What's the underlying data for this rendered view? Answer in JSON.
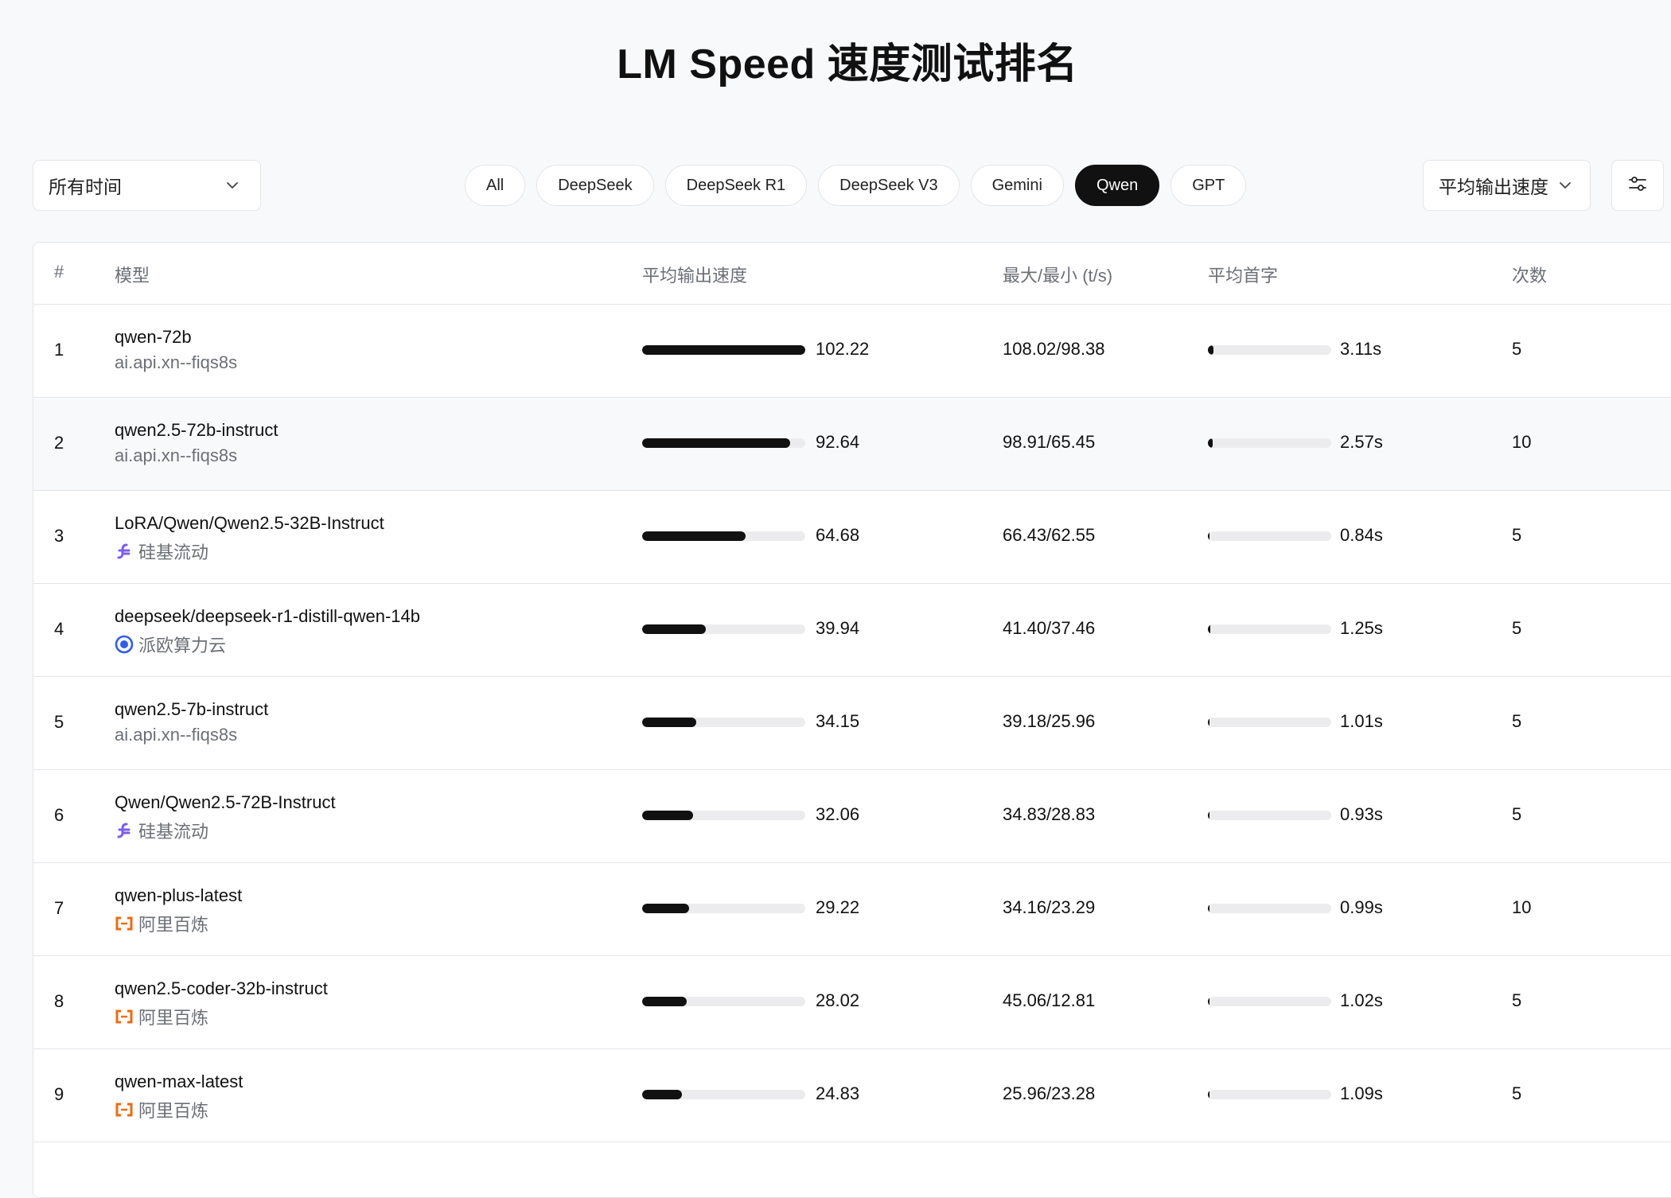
{
  "title": "LM Speed 速度测试排名",
  "time_filter": {
    "value": "所有时间"
  },
  "model_filters": [
    {
      "label": "All",
      "active": false
    },
    {
      "label": "DeepSeek",
      "active": false
    },
    {
      "label": "DeepSeek R1",
      "active": false
    },
    {
      "label": "DeepSeek V3",
      "active": false
    },
    {
      "label": "Gemini",
      "active": false
    },
    {
      "label": "Qwen",
      "active": true
    },
    {
      "label": "GPT",
      "active": false
    }
  ],
  "sort_select": {
    "value": "平均输出速度"
  },
  "table": {
    "headers": {
      "rank": "#",
      "model": "模型",
      "avg_speed": "平均输出速度",
      "max_min": "最大/最小 (t/s)",
      "avg_ttft": "平均首字",
      "count": "次数"
    },
    "max_speed": 102.22,
    "rows": [
      {
        "rank": "1",
        "model": "qwen-72b",
        "provider": "ai.api.xn--fiqs8s",
        "provider_icon": "none",
        "speed": "102.22",
        "speed_value": 102.22,
        "max_min": "108.02/98.38",
        "ttft": "3.11s",
        "ttft_fraction": 0.045,
        "count": "5"
      },
      {
        "rank": "2",
        "model": "qwen2.5-72b-instruct",
        "provider": "ai.api.xn--fiqs8s",
        "provider_icon": "none",
        "speed": "92.64",
        "speed_value": 92.64,
        "max_min": "98.91/65.45",
        "ttft": "2.57s",
        "ttft_fraction": 0.037,
        "count": "10"
      },
      {
        "rank": "3",
        "model": "LoRA/Qwen/Qwen2.5-32B-Instruct",
        "provider": "硅基流动",
        "provider_icon": "siliconflow-icon",
        "speed": "64.68",
        "speed_value": 64.68,
        "max_min": "66.43/62.55",
        "ttft": "0.84s",
        "ttft_fraction": 0.012,
        "count": "5"
      },
      {
        "rank": "4",
        "model": "deepseek/deepseek-r1-distill-qwen-14b",
        "provider": "派欧算力云",
        "provider_icon": "ppio-icon",
        "speed": "39.94",
        "speed_value": 39.94,
        "max_min": "41.40/37.46",
        "ttft": "1.25s",
        "ttft_fraction": 0.018,
        "count": "5"
      },
      {
        "rank": "5",
        "model": "qwen2.5-7b-instruct",
        "provider": "ai.api.xn--fiqs8s",
        "provider_icon": "none",
        "speed": "34.15",
        "speed_value": 34.15,
        "max_min": "39.18/25.96",
        "ttft": "1.01s",
        "ttft_fraction": 0.015,
        "count": "5"
      },
      {
        "rank": "6",
        "model": "Qwen/Qwen2.5-72B-Instruct",
        "provider": "硅基流动",
        "provider_icon": "siliconflow-icon",
        "speed": "32.06",
        "speed_value": 32.06,
        "max_min": "34.83/28.83",
        "ttft": "0.93s",
        "ttft_fraction": 0.013,
        "count": "5"
      },
      {
        "rank": "7",
        "model": "qwen-plus-latest",
        "provider": "阿里百炼",
        "provider_icon": "aliyun-icon",
        "speed": "29.22",
        "speed_value": 29.22,
        "max_min": "34.16/23.29",
        "ttft": "0.99s",
        "ttft_fraction": 0.014,
        "count": "10"
      },
      {
        "rank": "8",
        "model": "qwen2.5-coder-32b-instruct",
        "provider": "阿里百炼",
        "provider_icon": "aliyun-icon",
        "speed": "28.02",
        "speed_value": 28.02,
        "max_min": "45.06/12.81",
        "ttft": "1.02s",
        "ttft_fraction": 0.015,
        "count": "5"
      },
      {
        "rank": "9",
        "model": "qwen-max-latest",
        "provider": "阿里百炼",
        "provider_icon": "aliyun-icon",
        "speed": "24.83",
        "speed_value": 24.83,
        "max_min": "25.96/23.28",
        "ttft": "1.09s",
        "ttft_fraction": 0.016,
        "count": "5"
      }
    ]
  },
  "colors": {
    "accent": "#111111",
    "track": "#ececee",
    "siliconflow": "#7c5cf0",
    "ppio": "#2f5cf5",
    "aliyun": "#f06a0f"
  }
}
